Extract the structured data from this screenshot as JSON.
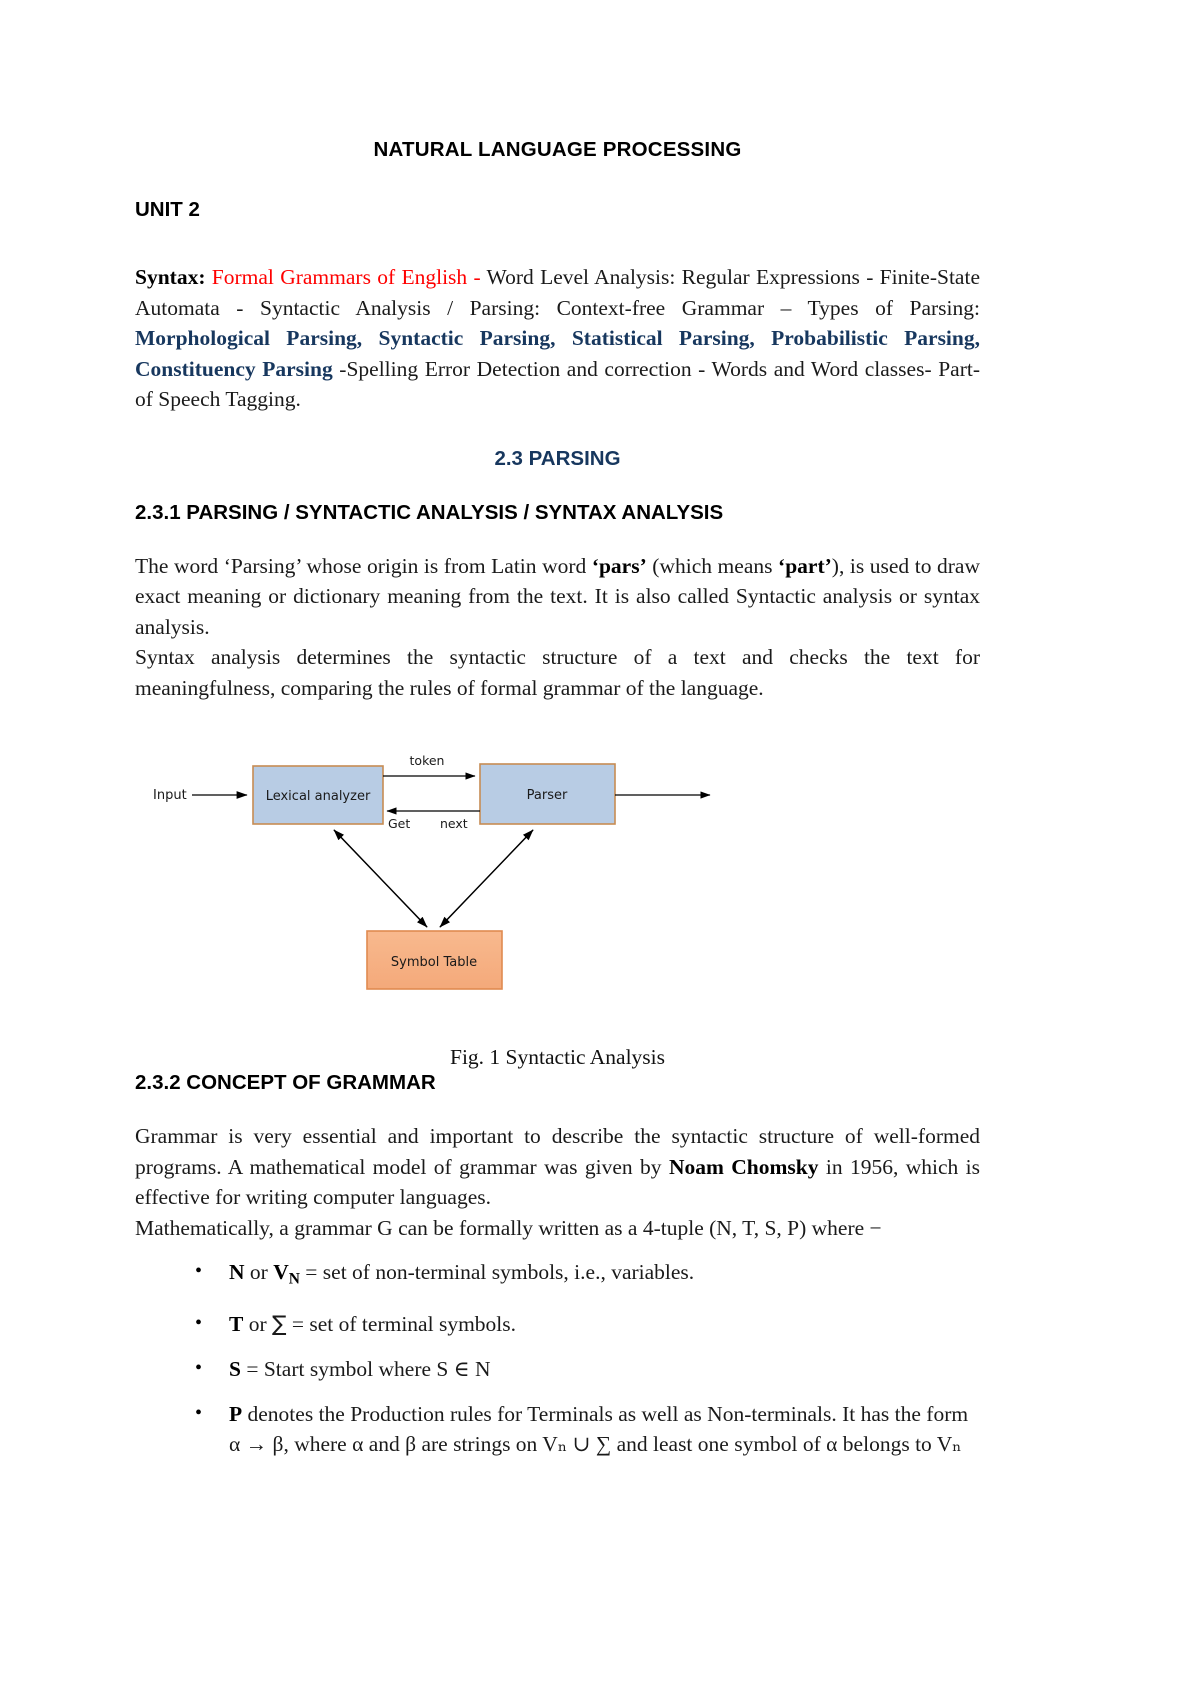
{
  "document": {
    "title": "NATURAL LANGUAGE PROCESSING",
    "unit": "UNIT 2",
    "syllabus": {
      "label": "Syntax:",
      "red_part": "Formal Grammars of English - ",
      "plain_part_1": " Word Level Analysis: Regular Expressions - Finite-State Automata - Syntactic Analysis / Parsing: Context-free Grammar – Types of Parsing: ",
      "navy_part": "Morphological Parsing, Syntactic Parsing, Statistical Parsing, Probabilistic Parsing, Constituency Parsing",
      "plain_part_2": " -Spelling Error Detection and correction - Words and Word classes- Part-of Speech Tagging."
    },
    "section_heading": "2.3 PARSING",
    "subsection_1": {
      "heading": "2.3.1 PARSING / SYNTACTIC ANALYSIS / SYNTAX ANALYSIS",
      "paragraph_1": {
        "t1": "The word ‘Parsing’ whose origin is from Latin word ",
        "b1": "‘pars’",
        "t2": " (which means ",
        "b2": "‘part’",
        "t3": "), is used to draw exact meaning or dictionary meaning from the text. It is also called Syntactic analysis or syntax analysis."
      },
      "paragraph_2": "Syntax analysis determines the syntactic structure of a text and checks the text for meaningfulness, comparing the rules of formal grammar of the language."
    },
    "figure": {
      "caption": "Fig. 1 Syntactic Analysis",
      "nodes": {
        "lexical_analyzer": "Lexical analyzer",
        "parser": "Parser",
        "symbol_table": "Symbol Table"
      },
      "labels": {
        "input": "Input",
        "token": "token",
        "get": "Get",
        "next": "next"
      },
      "colors": {
        "box_fill_blue": "#b8cce4",
        "box_border_blue": "#c68c53",
        "box_fill_orange": "#f6b183",
        "box_border_orange": "#e36c09",
        "arrow": "#000000"
      }
    },
    "subsection_2": {
      "heading": "2.3.2 CONCEPT OF GRAMMAR",
      "paragraph_1": {
        "t1": "Grammar is very essential and important to describe the syntactic structure of well-formed programs. A mathematical model of grammar was given by ",
        "b1": "Noam Chomsky",
        "t2": " in 1956, which is effective for writing computer languages."
      },
      "paragraph_2": "Mathematically, a grammar G can be formally written as a 4-tuple (N, T, S, P) where −",
      "bullets": [
        {
          "bold_lead": "N",
          "text_a": " or ",
          "bold_sym": "V",
          "sub": "N",
          "text_b": " = set of non-terminal symbols, i.e., variables."
        },
        {
          "bold_lead": "T",
          "text_a": " or ",
          "bold_sym": "∑",
          "sub": "",
          "text_b": " = set of terminal symbols."
        },
        {
          "bold_lead": "S",
          "text_a": "",
          "bold_sym": "",
          "sub": "",
          "text_b": " = Start symbol where S ∈ N"
        },
        {
          "bold_lead": "P",
          "text_a": "",
          "bold_sym": "",
          "sub": "",
          "text_b": " denotes the Production rules for Terminals as well as Non-terminals. It has the form α → β, where α and β are strings on Vₙ ∪ ∑ and least one symbol of α belongs to Vₙ"
        }
      ]
    }
  }
}
